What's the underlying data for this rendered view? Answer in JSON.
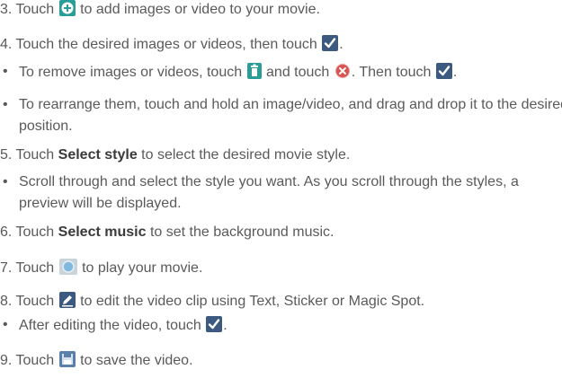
{
  "steps": {
    "s3": {
      "num": "3.",
      "pre": "Touch",
      "post": "to add images or video to your movie."
    },
    "s4": {
      "num": "4.",
      "pre": "Touch the desired images or videos, then touch",
      "post": "."
    },
    "b4a": {
      "pre": "To remove images or videos, touch",
      "mid": "and touch",
      "mid2": ". Then touch",
      "post": "."
    },
    "b4b": {
      "text": "To rearrange them, touch and hold an image/video, and drag and drop it to the desired position."
    },
    "s5": {
      "num": "5.",
      "pre": "Touch",
      "bold": "Select style",
      "post": "to select the desired movie style."
    },
    "b5": {
      "text": "Scroll through and select the style you want. As you scroll through the styles, a preview will be displayed."
    },
    "s6": {
      "num": "6.",
      "pre": "Touch",
      "bold": "Select music",
      "post": "to set the background music."
    },
    "s7": {
      "num": "7.",
      "pre": "Touch",
      "post": "to play your movie."
    },
    "s8": {
      "num": "8.",
      "pre": "Touch",
      "post": "to edit the video clip using Text, Sticker or Magic Spot."
    },
    "b8": {
      "pre": "After editing the video, touch",
      "post": "."
    },
    "s9": {
      "num": "9.",
      "pre": "Touch",
      "post": "to save the video."
    }
  },
  "bullet_glyph": "•",
  "icons": {
    "add": "add-circle-icon",
    "check": "checkmark-icon",
    "trash": "trash-icon",
    "remove": "remove-x-icon",
    "play": "play-preview-icon",
    "edit": "edit-pencil-icon",
    "save": "save-icon"
  },
  "colors": {
    "text": "#5a5a5a",
    "bold_text": "#3a3a3a",
    "icon_teal": "#2a9d96",
    "icon_check_bg": "#3c5a80",
    "icon_remove": "#d9534f"
  }
}
